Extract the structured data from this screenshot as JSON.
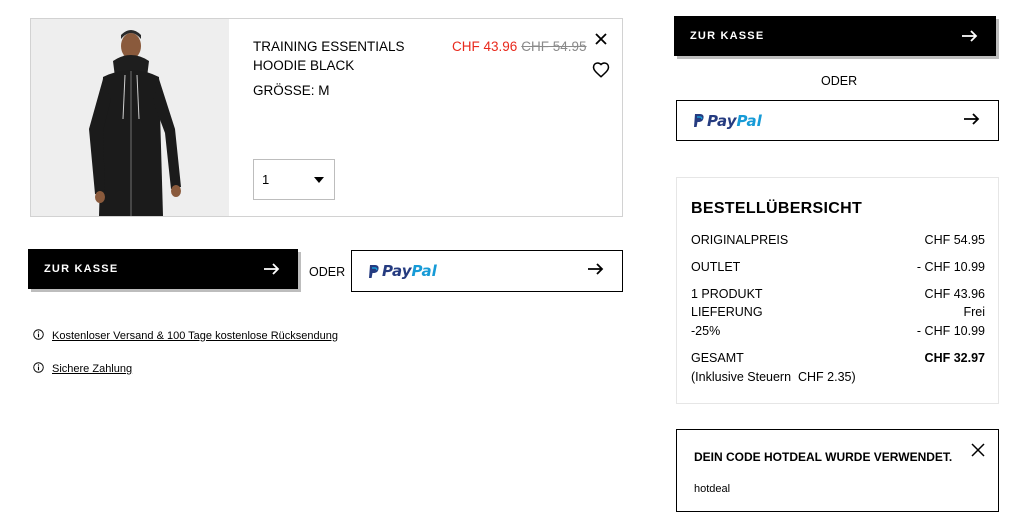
{
  "cart": {
    "item": {
      "name": "TRAINING ESSENTIALS HOODIE BLACK",
      "price_sale": "CHF 43.96",
      "price_original": "CHF 54.95",
      "size": "GRÖSSE: M",
      "quantity": "1"
    },
    "checkout_label": "ZUR KASSE",
    "paypal_pay": "Pay",
    "paypal_pal": "Pal",
    "or_label": "ODER",
    "info": {
      "shipping": "Kostenloser Versand & 100 Tage kostenlose Rücksendung",
      "payment": "Sichere Zahlung"
    }
  },
  "sidebar": {
    "checkout_label": "ZUR KASSE",
    "or_label": "ODER",
    "paypal_pay": "Pay",
    "paypal_pal": "Pal"
  },
  "summary": {
    "title": "BESTELLÜBERSICHT",
    "rows": [
      {
        "label": "ORIGINALPREIS",
        "value": "CHF 54.95"
      },
      {
        "label": "OUTLET",
        "value": "- CHF 10.99"
      },
      {
        "label": "1 PRODUKT",
        "value": "CHF 43.96"
      },
      {
        "label": "LIEFERUNG",
        "value": "Frei"
      },
      {
        "label": "-25%",
        "value": "- CHF 10.99"
      },
      {
        "label": "GESAMT",
        "value": "CHF 32.97"
      }
    ],
    "tax_note": "(Inklusive Steuern  CHF 2.35)"
  },
  "coupon": {
    "message": "DEIN CODE HOTDEAL WURDE VERWENDET.",
    "code": "hotdeal"
  },
  "colors": {
    "sale_red": "#e8291c",
    "paypal_dark": "#253b80",
    "paypal_light": "#179bd7"
  }
}
